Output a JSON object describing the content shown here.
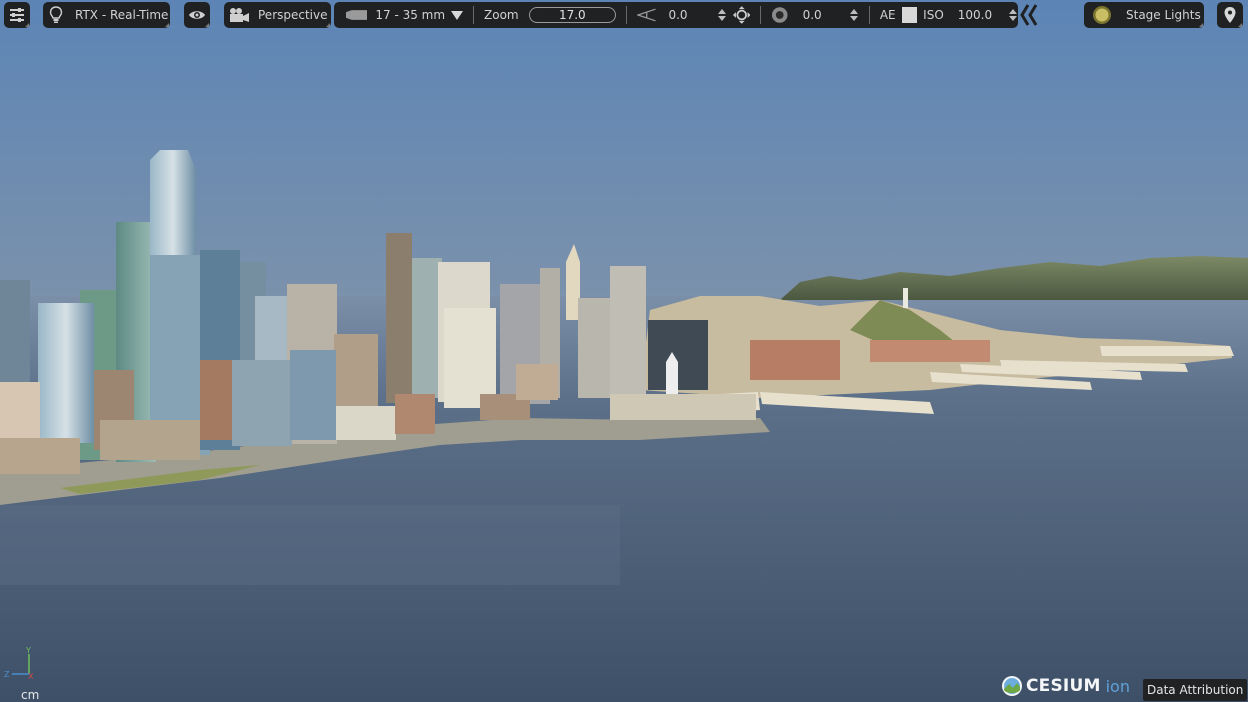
{
  "toolbar": {
    "settings_icon": "sliders-icon",
    "renderer": {
      "icon": "lightbulb-icon",
      "label": "RTX - Real-Time"
    },
    "visibility_icon": "eye-icon",
    "camera": {
      "icon": "movie-camera-icon",
      "label": "Perspective"
    },
    "lens": {
      "icon": "lens-icon",
      "focal_range": "17 - 35 mm",
      "dropdown_icon": "triangle-down-icon",
      "zoom_label": "Zoom",
      "zoom_value": "17.0",
      "angle_icon": "angle-icon",
      "angle_value": "0.0",
      "move_icon": "move-arrows-icon",
      "aperture_icon": "aperture-icon",
      "aperture_value": "0.0",
      "ae_label": "AE",
      "ae_checked": false,
      "iso_label": "ISO",
      "iso_value": "100.0"
    },
    "collapse_icon": "double-chevron-left-icon",
    "lights": {
      "icon": "sun-icon",
      "label": "Stage Lights"
    },
    "location_icon": "map-pin-icon"
  },
  "viewport": {
    "scene": "San Francisco waterfront 3D tiles",
    "colors": {
      "sky_top": "#5f86b5",
      "horizon": "#a4998f",
      "water": "#4a5d73",
      "hills": "#5d6b4a"
    }
  },
  "axis_gizmo": {
    "x_label": "X",
    "y_label": "Y",
    "z_label": "Z",
    "x_color": "#d0484a",
    "y_color": "#6fbf5a",
    "z_color": "#4b8ec9"
  },
  "unit_label": "cm",
  "branding": {
    "name": "CESIUM",
    "suffix": "ion"
  },
  "data_attribution_label": "Data Attribution"
}
